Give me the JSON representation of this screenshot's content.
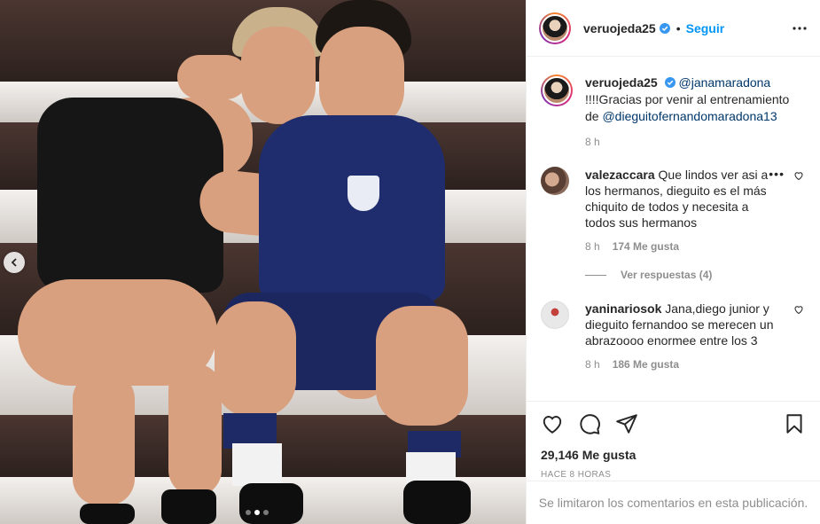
{
  "post": {
    "author": "veruojeda25",
    "follow_label": "Seguir",
    "separator": "•"
  },
  "caption": {
    "author": "veruojeda25",
    "mention": "@janamaradona",
    "text": "!!!!Gracias por venir al entrenamiento de",
    "mention2": "@dieguitofernandomaradona13",
    "time": "8 h"
  },
  "comments": [
    {
      "user": "valezaccara",
      "text": "Que lindos ver asi a los hermanos, dieguito es el más chiquito de todos y necesita a todos sus hermanos",
      "time": "8 h",
      "likes": "174 Me gusta",
      "replies": "Ver respuestas (4)"
    },
    {
      "user": "yaninariosok",
      "text": "Jana,diego junior y dieguito fernandoo se merecen un abrazoooo enormee entre los 3",
      "time": "8 h",
      "likes": "186 Me gusta"
    }
  ],
  "stats": {
    "likes": "29,146 Me gusta",
    "timeago": "HACE 8 HORAS"
  },
  "footer": {
    "text": "Se limitaron los comentarios en esta publicación."
  },
  "carousel": {
    "slides": 3,
    "active": 2
  },
  "colors": {
    "link": "#00376b",
    "follow": "#0095f6",
    "verified": "#3897f0",
    "muted": "#8e8e8e"
  },
  "icons": [
    "chevron-left-icon",
    "verified-badge-icon",
    "more-options-icon",
    "heart-icon",
    "comment-icon",
    "share-icon",
    "bookmark-icon"
  ]
}
